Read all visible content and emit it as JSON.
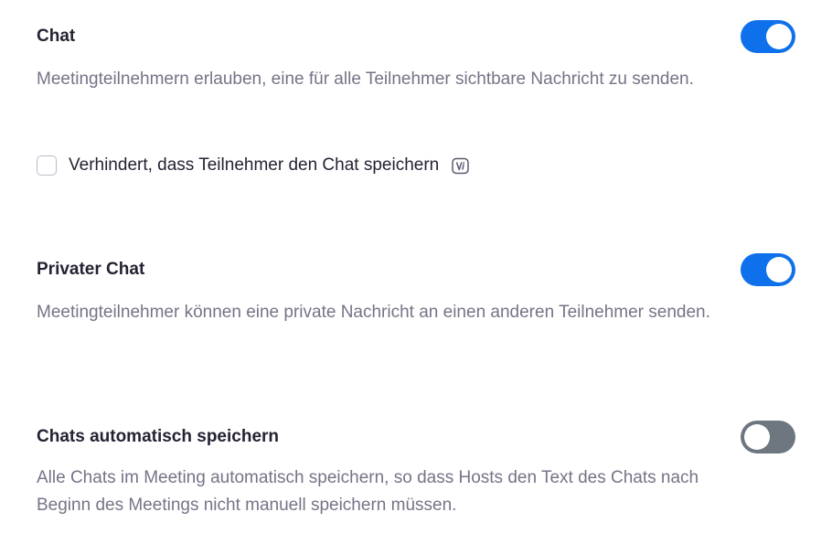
{
  "settings": [
    {
      "title": "Chat",
      "description": "Meetingteilnehmern erlauben, eine für alle Teilnehmer sichtbare Nachricht zu senden.",
      "enabled": true,
      "option": {
        "label": "Verhindert, dass Teilnehmer den Chat speichern",
        "checked": false,
        "icon": "version-icon"
      }
    },
    {
      "title": "Privater Chat",
      "description": "Meetingteilnehmer können eine private Nachricht an einen anderen Teilnehmer senden.",
      "enabled": true
    },
    {
      "title": "Chats automatisch speichern",
      "description": "Alle Chats im Meeting automatisch speichern, so dass Hosts den Text des Chats nach Beginn des Meetings nicht manuell speichern müssen.",
      "enabled": false
    }
  ],
  "colors": {
    "toggle_on": "#0e71eb",
    "toggle_off": "#6e7680",
    "title": "#232333",
    "description": "#747487"
  }
}
